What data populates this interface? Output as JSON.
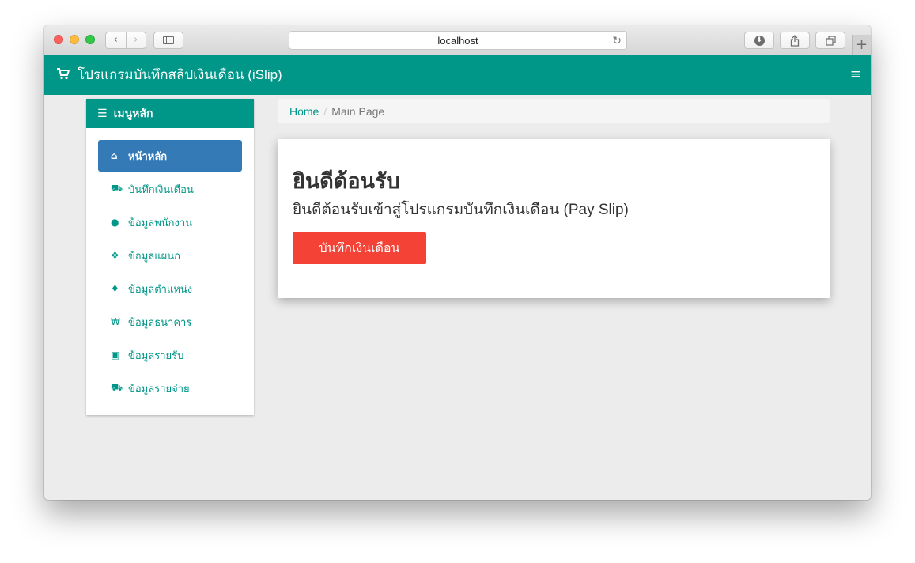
{
  "browser": {
    "url": "localhost",
    "nav_back": "‹",
    "nav_forward": "›",
    "reload_icon": "reload-icon",
    "new_tab": "+"
  },
  "navbar": {
    "brand_title": "โปรแกรมบันทึกสลิปเงินเดือน (iSlip)",
    "brand_icon": "cart-icon",
    "menu_icon": "hamburger-icon",
    "color": "#009688"
  },
  "sidebar": {
    "title": "เมนูหลัก",
    "items": [
      {
        "label": "หน้าหลัก",
        "icon": "home-icon",
        "active": true
      },
      {
        "label": "บันทึกเงินเดือน",
        "icon": "cart-icon",
        "active": false
      },
      {
        "label": "ข้อมูลพนักงาน",
        "icon": "users-icon",
        "active": false
      },
      {
        "label": "ข้อมูลแผนก",
        "icon": "cubes-icon",
        "active": false
      },
      {
        "label": "ข้อมูลตำแหน่ง",
        "icon": "flame-icon",
        "active": false
      },
      {
        "label": "ข้อมูลธนาคาร",
        "icon": "bank-icon",
        "active": false
      },
      {
        "label": "ข้อมูลรายรับ",
        "icon": "money-icon",
        "active": false
      },
      {
        "label": "ข้อมูลรายจ่าย",
        "icon": "cart-icon",
        "active": false
      }
    ],
    "active_color": "#337ab7"
  },
  "breadcrumb": {
    "home": "Home",
    "separator": "/",
    "current": "Main Page"
  },
  "welcome": {
    "title": "ยินดีต้อนรับ",
    "subtitle": "ยินดีต้อนรับเข้าสู่โปรแกรมบันทึกเงินเดือน (Pay Slip)",
    "button_label": "บันทึกเงินเดือน",
    "button_color": "#f44336"
  }
}
